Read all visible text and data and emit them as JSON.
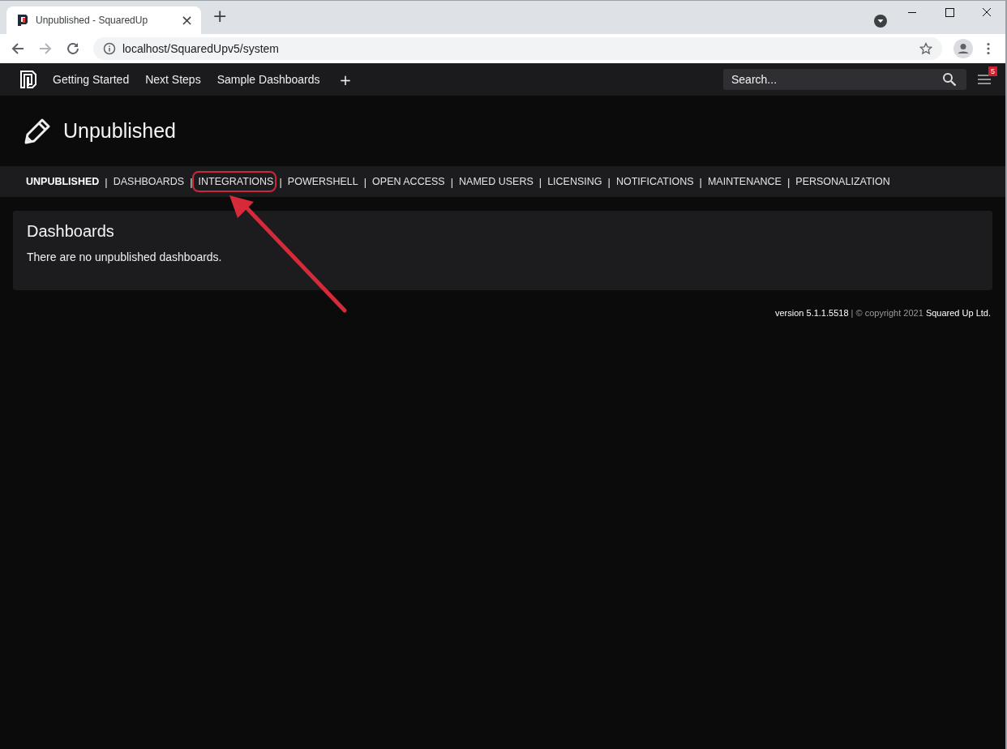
{
  "browser": {
    "tab_title": "Unpublished - SquaredUp",
    "tab_close": "×",
    "new_tab": "+",
    "url": "localhost/SquaredUpv5/system"
  },
  "app_nav": {
    "links": [
      {
        "label": "Getting Started"
      },
      {
        "label": "Next Steps"
      },
      {
        "label": "Sample Dashboards"
      }
    ],
    "add": "+",
    "search": {
      "placeholder": "Search..."
    },
    "notification_count": "5"
  },
  "page": {
    "title": "Unpublished"
  },
  "subnav": [
    {
      "kind": "link",
      "label": "UNPUBLISHED",
      "selected": true,
      "annotated": false
    },
    {
      "kind": "separator",
      "label": "|"
    },
    {
      "kind": "link",
      "label": "DASHBOARDS",
      "selected": false,
      "annotated": false
    },
    {
      "kind": "separator",
      "label": "|"
    },
    {
      "kind": "link",
      "label": "INTEGRATIONS",
      "selected": false,
      "annotated": true
    },
    {
      "kind": "separator",
      "label": "|"
    },
    {
      "kind": "link",
      "label": "POWERSHELL",
      "selected": false,
      "annotated": false
    },
    {
      "kind": "separator",
      "label": "|"
    },
    {
      "kind": "link",
      "label": "OPEN ACCESS",
      "selected": false,
      "annotated": false
    },
    {
      "kind": "separator",
      "label": "|"
    },
    {
      "kind": "link",
      "label": "NAMED USERS",
      "selected": false,
      "annotated": false
    },
    {
      "kind": "separator",
      "label": "|"
    },
    {
      "kind": "link",
      "label": "LICENSING",
      "selected": false,
      "annotated": false
    },
    {
      "kind": "separator",
      "label": "|"
    },
    {
      "kind": "link",
      "label": "NOTIFICATIONS",
      "selected": false,
      "annotated": false
    },
    {
      "kind": "separator",
      "label": "|"
    },
    {
      "kind": "link",
      "label": "MAINTENANCE",
      "selected": false,
      "annotated": false
    },
    {
      "kind": "separator",
      "label": "|"
    },
    {
      "kind": "link",
      "label": "PERSONALIZATION",
      "selected": false,
      "annotated": false
    }
  ],
  "card": {
    "title": "Dashboards",
    "message": "There are no unpublished dashboards."
  },
  "footer": "**version 5.1.1.5518** | © copyright 2021 **Squared Up Ltd.**"
}
